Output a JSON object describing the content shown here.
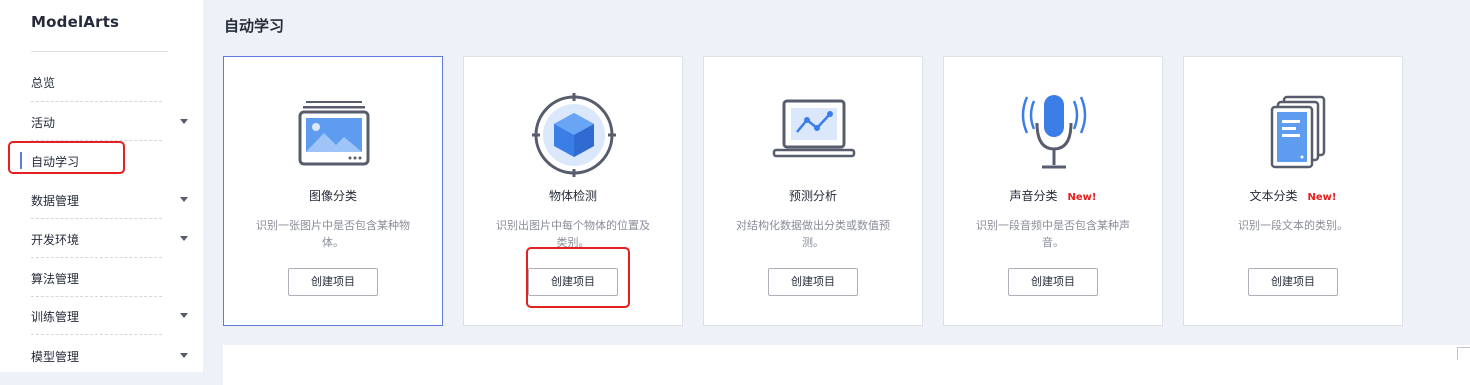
{
  "sidebar": {
    "brand": "ModelArts",
    "items": [
      {
        "label": "总览",
        "has_caret": false
      },
      {
        "label": "活动",
        "has_caret": true
      },
      {
        "label": "自动学习",
        "has_caret": false,
        "active": true
      },
      {
        "label": "数据管理",
        "has_caret": true
      },
      {
        "label": "开发环境",
        "has_caret": true
      },
      {
        "label": "算法管理",
        "has_caret": false
      },
      {
        "label": "训练管理",
        "has_caret": true
      },
      {
        "label": "模型管理",
        "has_caret": true
      }
    ]
  },
  "main": {
    "title": "自动学习",
    "cards": [
      {
        "title": "图像分类",
        "badge": "",
        "desc": "识别一张图片中是否包含某种物体。",
        "button": "创建项目",
        "icon": "image-classification-icon"
      },
      {
        "title": "物体检测",
        "badge": "",
        "desc": "识别出图片中每个物体的位置及类别。",
        "button": "创建项目",
        "icon": "object-detection-icon"
      },
      {
        "title": "预测分析",
        "badge": "",
        "desc": "对结构化数据做出分类或数值预测。",
        "button": "创建项目",
        "icon": "predictive-analysis-icon"
      },
      {
        "title": "声音分类",
        "badge": "New!",
        "desc": "识别一段音频中是否包含某种声音。",
        "button": "创建项目",
        "icon": "sound-classification-icon"
      },
      {
        "title": "文本分类",
        "badge": "New!",
        "desc": "识别一段文本的类别。",
        "button": "创建项目",
        "icon": "text-classification-icon"
      }
    ]
  },
  "colors": {
    "accent": "#5e7ce0",
    "highlight": "#e52020",
    "new_badge": "#e52020"
  }
}
